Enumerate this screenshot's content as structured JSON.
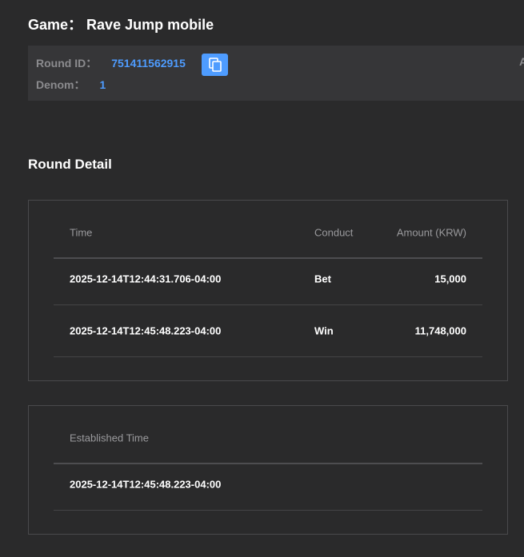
{
  "header": {
    "game_label": "Game：",
    "game_name": "Rave Jump mobile"
  },
  "info": {
    "round_id_label": "Round ID：",
    "round_id_value": "751411562915",
    "denom_label": "Denom：",
    "denom_value": "1",
    "edge_text": "A"
  },
  "round_detail": {
    "title": "Round Detail",
    "columns": {
      "time": "Time",
      "conduct": "Conduct",
      "amount": "Amount (KRW)"
    },
    "rows": [
      {
        "time": "2025-12-14T12:44:31.706-04:00",
        "conduct": "Bet",
        "amount": "15,000"
      },
      {
        "time": "2025-12-14T12:45:48.223-04:00",
        "conduct": "Win",
        "amount": "11,748,000"
      }
    ]
  },
  "established": {
    "header": "Established Time",
    "value": "2025-12-14T12:45:48.223-04:00"
  },
  "colors": {
    "background": "#2a2a2b",
    "panel": "#363638",
    "accent": "#4e9cff",
    "muted_text": "#8b8b8e"
  },
  "icons": {
    "copy": "copy-icon"
  }
}
